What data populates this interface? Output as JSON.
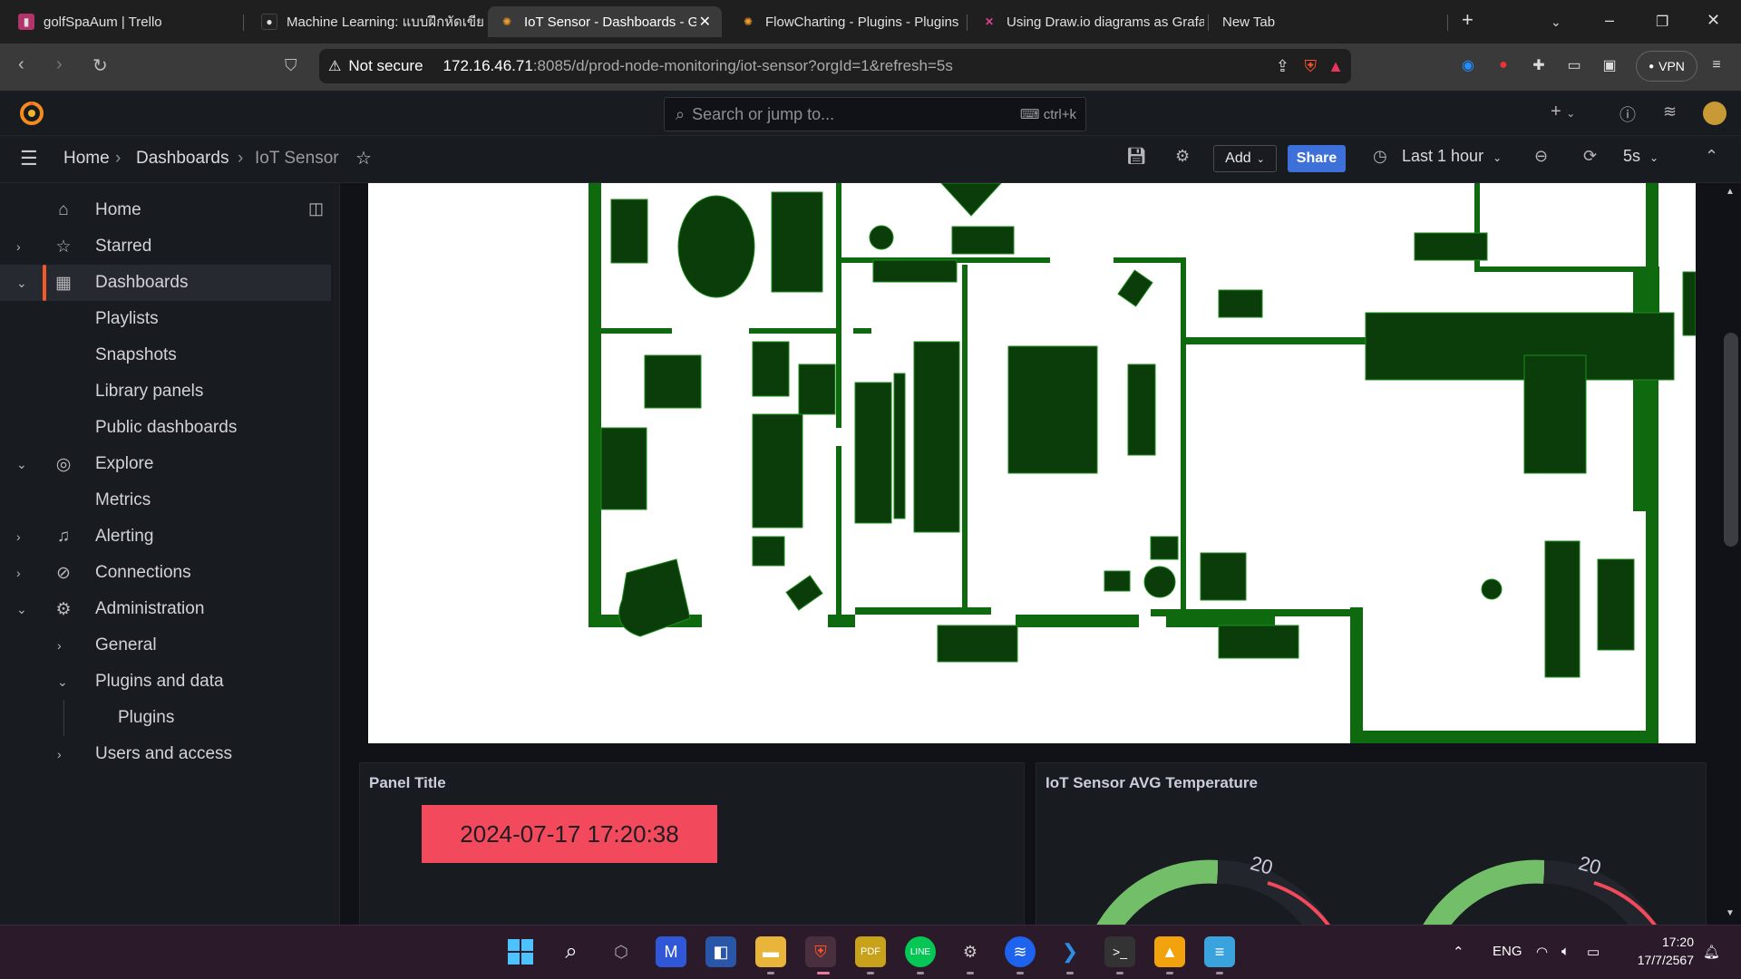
{
  "browser": {
    "tabs": [
      {
        "label": "golfSpaAum | Trello",
        "active": false,
        "icon": "trello-icon"
      },
      {
        "label": "Machine Learning: แบบฝึกหัดเขียน",
        "active": false,
        "icon": "github-icon"
      },
      {
        "label": "IoT Sensor - Dashboards - G",
        "active": true,
        "icon": "grafana-icon"
      },
      {
        "label": "FlowCharting - Plugins - Plugins",
        "active": false,
        "icon": "grafana-icon"
      },
      {
        "label": "Using Draw.io diagrams as Grafa",
        "active": false,
        "icon": "x-icon"
      },
      {
        "label": "New Tab",
        "active": false,
        "icon": ""
      }
    ],
    "security_label": "Not secure",
    "url_host": "172.16.46.71",
    "url_rest": ":8085/d/prod-node-monitoring/iot-sensor?orgId=1&refresh=5s",
    "vpn_label": "VPN"
  },
  "grafana": {
    "search_placeholder": "Search or jump to...",
    "search_shortcut": "ctrl+k",
    "breadcrumb": [
      "Home",
      "Dashboards",
      "IoT Sensor"
    ],
    "add_label": "Add",
    "share_label": "Share",
    "time_range": "Last 1 hour",
    "refresh_interval": "5s"
  },
  "sidebar": {
    "items": [
      {
        "label": "Home",
        "icon": "home-icon",
        "chevron": "",
        "indent": 0
      },
      {
        "label": "Starred",
        "icon": "star-icon",
        "chevron": "›",
        "indent": 0
      },
      {
        "label": "Dashboards",
        "icon": "dashboards-icon",
        "chevron": "⌄",
        "indent": 0,
        "active": true
      },
      {
        "label": "Playlists",
        "icon": "",
        "chevron": "",
        "indent": 1
      },
      {
        "label": "Snapshots",
        "icon": "",
        "chevron": "",
        "indent": 1
      },
      {
        "label": "Library panels",
        "icon": "",
        "chevron": "",
        "indent": 1
      },
      {
        "label": "Public dashboards",
        "icon": "",
        "chevron": "",
        "indent": 1
      },
      {
        "label": "Explore",
        "icon": "compass-icon",
        "chevron": "⌄",
        "indent": 0
      },
      {
        "label": "Metrics",
        "icon": "",
        "chevron": "",
        "indent": 1
      },
      {
        "label": "Alerting",
        "icon": "bell-icon",
        "chevron": "›",
        "indent": 0
      },
      {
        "label": "Connections",
        "icon": "connections-icon",
        "chevron": "›",
        "indent": 0
      },
      {
        "label": "Administration",
        "icon": "gear-icon",
        "chevron": "⌄",
        "indent": 0
      },
      {
        "label": "General",
        "icon": "",
        "chevron": "›",
        "indent": 1
      },
      {
        "label": "Plugins and data",
        "icon": "",
        "chevron": "⌄",
        "indent": 1
      },
      {
        "label": "Plugins",
        "icon": "",
        "chevron": "",
        "indent": 2
      },
      {
        "label": "Users and access",
        "icon": "",
        "chevron": "›",
        "indent": 1
      }
    ]
  },
  "panels": {
    "panel_title": "Panel Title",
    "timestamp": "2024-07-17 17:20:38",
    "temp_title": "IoT Sensor AVG Temperature",
    "gauge_tick_label": "20"
  },
  "taskbar": {
    "lang": "ENG",
    "time": "17:20",
    "date": "17/7/2567"
  },
  "colors": {
    "floorplan_green": "#0b3d0b",
    "floorplan_wall": "#0f6a0f",
    "accent_orange": "#f05a28",
    "timestamp_bg": "#f2495c",
    "gauge_green": "#73bf69",
    "gauge_red": "#f2495c",
    "share_blue": "#3d71d9"
  }
}
